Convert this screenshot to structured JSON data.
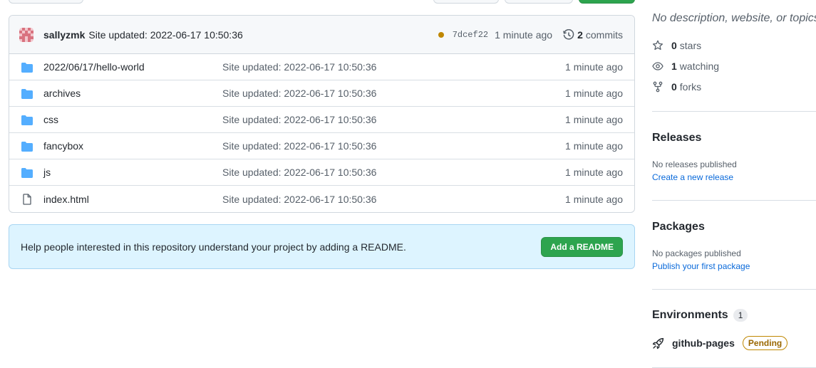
{
  "commit_bar": {
    "author": "sallyzmk",
    "message": "Site updated: 2022-06-17 10:50:36",
    "sha": "7dcef22",
    "time": "1 minute ago",
    "commit_count": "2",
    "commits_label": "commits",
    "status_color": "#bf8700"
  },
  "files": [
    {
      "name": "2022/06/17/hello-world",
      "type": "folder-icon",
      "commit": "Site updated: 2022-06-17 10:50:36",
      "time": "1 minute ago"
    },
    {
      "name": "archives",
      "type": "folder-icon",
      "commit": "Site updated: 2022-06-17 10:50:36",
      "time": "1 minute ago"
    },
    {
      "name": "css",
      "type": "folder-icon",
      "commit": "Site updated: 2022-06-17 10:50:36",
      "time": "1 minute ago"
    },
    {
      "name": "fancybox",
      "type": "folder-icon",
      "commit": "Site updated: 2022-06-17 10:50:36",
      "time": "1 minute ago"
    },
    {
      "name": "js",
      "type": "folder-icon",
      "commit": "Site updated: 2022-06-17 10:50:36",
      "time": "1 minute ago"
    },
    {
      "name": "index.html",
      "type": "file-icon",
      "commit": "Site updated: 2022-06-17 10:50:36",
      "time": "1 minute ago"
    }
  ],
  "readme": {
    "text": "Help people interested in this repository understand your project by adding a README.",
    "button": "Add a README"
  },
  "about": {
    "description": "No description, website, or topics provided.",
    "stars_count": "0",
    "stars_label": "stars",
    "watching_count": "1",
    "watching_label": "watching",
    "forks_count": "0",
    "forks_label": "forks"
  },
  "releases": {
    "title": "Releases",
    "empty": "No releases published",
    "link": "Create a new release"
  },
  "packages": {
    "title": "Packages",
    "empty": "No packages published",
    "link": "Publish your first package"
  },
  "environments": {
    "title": "Environments",
    "count": "1",
    "items": [
      {
        "name": "github-pages",
        "status": "Pending"
      }
    ]
  },
  "colors": {
    "accent_green": "#2da44e",
    "link_blue": "#0969da",
    "folder_blue": "#54aeff",
    "pending_yellow": "#bf8700"
  }
}
